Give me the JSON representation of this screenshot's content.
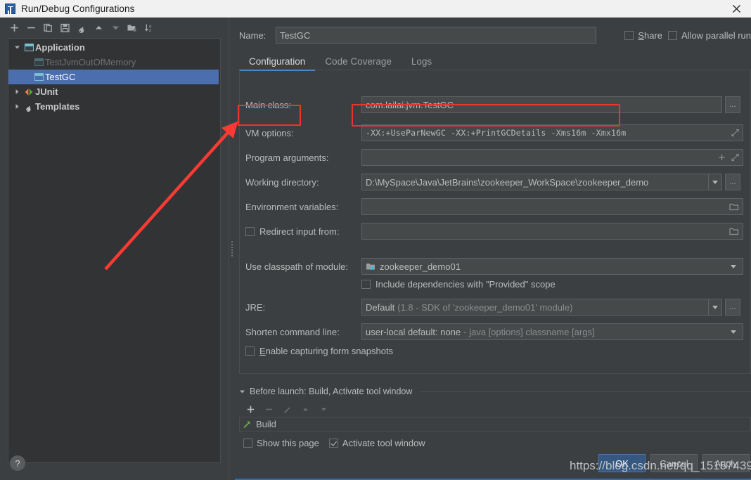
{
  "window": {
    "title": "Run/Debug Configurations",
    "logo_icon": "intellij-idea-logo-icon",
    "close_icon": "close-icon"
  },
  "left_panel": {
    "toolbar": [
      {
        "name": "add-configuration-button",
        "icon": "plus-icon",
        "label": "+"
      },
      {
        "name": "remove-configuration-button",
        "icon": "minus-icon",
        "label": "−"
      },
      {
        "name": "copy-configuration-button",
        "icon": "copy-icon",
        "label": ""
      },
      {
        "name": "save-configuration-button",
        "icon": "save-icon",
        "label": ""
      },
      {
        "name": "edit-templates-button",
        "icon": "wrench-icon",
        "label": ""
      },
      {
        "name": "move-up-button",
        "icon": "arrow-up-icon",
        "label": ""
      },
      {
        "name": "move-down-button",
        "icon": "arrow-down-icon",
        "label": ""
      },
      {
        "name": "new-folder-button",
        "icon": "folder-add-icon",
        "label": ""
      },
      {
        "name": "sort-configurations-button",
        "icon": "sort-az-icon",
        "label": ""
      }
    ],
    "tree": [
      {
        "label": "Application",
        "icon": "application-icon",
        "state": "expanded",
        "indent": 0,
        "selected": false,
        "bold": true
      },
      {
        "label": "TestJvmOutOfMemory",
        "icon": "application-icon",
        "state": "leaf",
        "indent": 1,
        "selected": false,
        "dim": true
      },
      {
        "label": "TestGC",
        "icon": "application-icon",
        "state": "leaf",
        "indent": 1,
        "selected": true,
        "dim": false
      },
      {
        "label": "JUnit",
        "icon": "junit-icon",
        "state": "collapsed",
        "indent": 0,
        "selected": false,
        "bold": true
      },
      {
        "label": "Templates",
        "icon": "wrench-icon",
        "state": "collapsed",
        "indent": 0,
        "selected": false,
        "bold": true
      }
    ]
  },
  "main": {
    "name_label": "Name:",
    "name_value": "TestGC",
    "share": {
      "label": "Share",
      "checked": false
    },
    "allow_parallel_run": {
      "label": "Allow parallel run",
      "checked": false
    },
    "tabs": [
      {
        "label": "Configuration",
        "active": true
      },
      {
        "label": "Code Coverage",
        "active": false
      },
      {
        "label": "Logs",
        "active": false
      }
    ],
    "fields": {
      "main_class": {
        "label": "Main class:",
        "value": "com.lailai.jvm.TestGC",
        "browse_label": "..."
      },
      "vm_options": {
        "label": "VM options:",
        "value": "-XX:+UseParNewGC -XX:+PrintGCDetails -Xms16m -Xmx16m",
        "expand_icon": "expand-icon"
      },
      "program_arguments": {
        "label": "Program arguments:",
        "value": "",
        "add_icon": "plus-icon",
        "expand_icon": "expand-icon"
      },
      "working_directory": {
        "label": "Working directory:",
        "value": "D:\\MySpace\\Java\\JetBrains\\zookeeper_WorkSpace\\zookeeper_demo",
        "browse_label": "..."
      },
      "environment_variables": {
        "label": "Environment variables:",
        "value": "",
        "browse_icon": "folder-icon"
      },
      "redirect_input_from": {
        "label": "Redirect input from:",
        "value": "",
        "checked": false,
        "browse_icon": "folder-icon"
      },
      "use_classpath_of_module": {
        "label": "Use classpath of module:",
        "value": "zookeeper_demo01",
        "icon": "module-icon"
      },
      "include_provided_scope": {
        "label": "Include dependencies with \"Provided\" scope",
        "checked": false
      },
      "jre": {
        "label": "JRE:",
        "value_strong": "Default",
        "value_dim": "(1.8 - SDK of 'zookeeper_demo01' module)",
        "browse_label": "..."
      },
      "shorten_command_line": {
        "label": "Shorten command line:",
        "value_strong": "user-local default: none",
        "value_dim": "- java [options] classname [args]"
      },
      "enable_form_snapshots": {
        "label": "Enable capturing form snapshots",
        "checked": false,
        "mnemonic": "E"
      }
    },
    "before_launch": {
      "title": "Before launch: Build, Activate tool window",
      "state": "expanded",
      "toolbar": [
        {
          "name": "add-task-button",
          "icon": "plus-icon",
          "enabled": true
        },
        {
          "name": "remove-task-button",
          "icon": "minus-icon",
          "enabled": false
        },
        {
          "name": "edit-task-button",
          "icon": "pencil-icon",
          "enabled": false
        },
        {
          "name": "move-task-up-button",
          "icon": "arrow-up-icon",
          "enabled": false
        },
        {
          "name": "move-task-down-button",
          "icon": "arrow-down-icon",
          "enabled": false
        }
      ],
      "items": [
        {
          "label": "Build",
          "icon": "build-hammer-icon"
        }
      ],
      "show_this_page": {
        "label": "Show this page",
        "checked": false
      },
      "activate_tool_window": {
        "label": "Activate tool window",
        "checked": true
      }
    }
  },
  "footer": {
    "help_label": "?",
    "buttons": [
      {
        "label": "OK",
        "primary": true,
        "name": "ok-button"
      },
      {
        "label": "Cancel",
        "primary": false,
        "name": "cancel-button"
      },
      {
        "label": "Apply",
        "primary": false,
        "name": "apply-button"
      }
    ]
  },
  "annotations": {
    "watermark_text": "https://blog.csdn.net/qq_15157439",
    "highlight_color": "#e8352e",
    "arrow_color": "#fb3b33"
  }
}
